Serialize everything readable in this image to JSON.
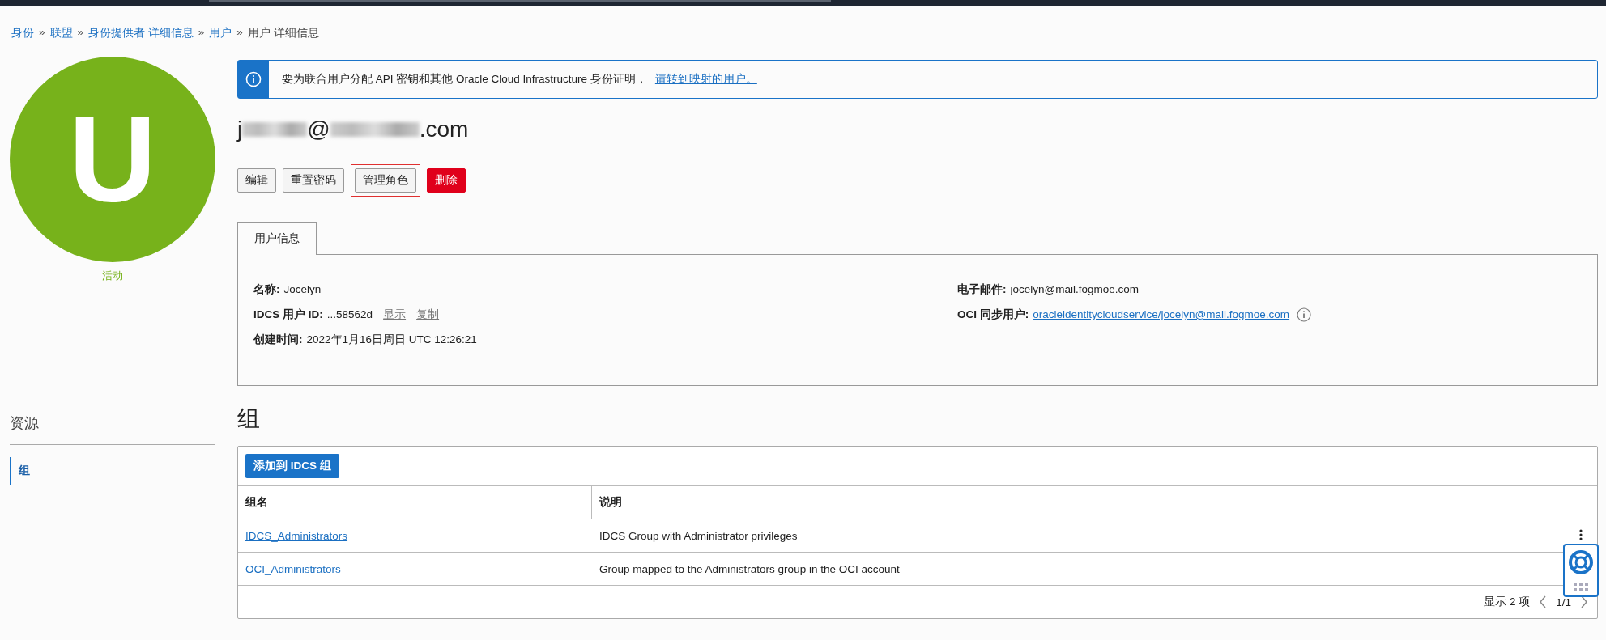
{
  "breadcrumb": [
    {
      "label": "身份",
      "link": true,
      "separator": "»"
    },
    {
      "label": "联盟",
      "link": true,
      "separator": "»"
    },
    {
      "label": "身份提供者 详细信息",
      "link": true,
      "separator": "»"
    },
    {
      "label": "用户",
      "link": true,
      "separator": "»"
    },
    {
      "label": "用户 详细信息",
      "link": false
    }
  ],
  "avatar": {
    "letter": "U",
    "status": "活动"
  },
  "banner": {
    "text": "要为联合用户分配 API 密钥和其他 Oracle Cloud Infrastructure 身份证明，",
    "link": "请转到映射的用户。"
  },
  "title_parts": [
    "j",
    "@",
    ".com"
  ],
  "buttons": [
    {
      "label": "编辑",
      "kind": "default",
      "highlighted": false
    },
    {
      "label": "重置密码",
      "kind": "default",
      "highlighted": false
    },
    {
      "label": "管理角色",
      "kind": "default",
      "highlighted": true
    },
    {
      "label": "删除",
      "kind": "danger",
      "highlighted": false
    }
  ],
  "tabs": [
    {
      "label": "用户信息",
      "selected": true
    }
  ],
  "info_left": [
    {
      "label": "名称:",
      "value": "Jocelyn"
    },
    {
      "label": "IDCS 用户 ID:",
      "value": "...58562d",
      "actions": [
        "显示",
        "复制"
      ]
    },
    {
      "label": "创建时间:",
      "value": "2022年1月16日周日 UTC 12:26:21"
    }
  ],
  "info_right": [
    {
      "label": "电子邮件:",
      "value": "jocelyn@mail.fogmoe.com",
      "kind": "text"
    },
    {
      "label": "OCI 同步用户:",
      "value": "oracleidentitycloudservice/jocelyn@mail.fogmoe.com",
      "kind": "link"
    }
  ],
  "resources": {
    "title": "资源",
    "items": [
      {
        "label": "组",
        "selected": true
      }
    ]
  },
  "groups": {
    "title": "组",
    "add_button": "添加到 IDCS 组",
    "columns": [
      "组名",
      "说明"
    ],
    "rows": [
      {
        "name": "IDCS_Administrators",
        "description": "IDCS Group with Administrator privileges"
      },
      {
        "name": "OCI_Administrators",
        "description": "Group mapped to the Administrators group in the OCI account"
      }
    ],
    "count": "显示 2 项",
    "page": "1/1"
  }
}
